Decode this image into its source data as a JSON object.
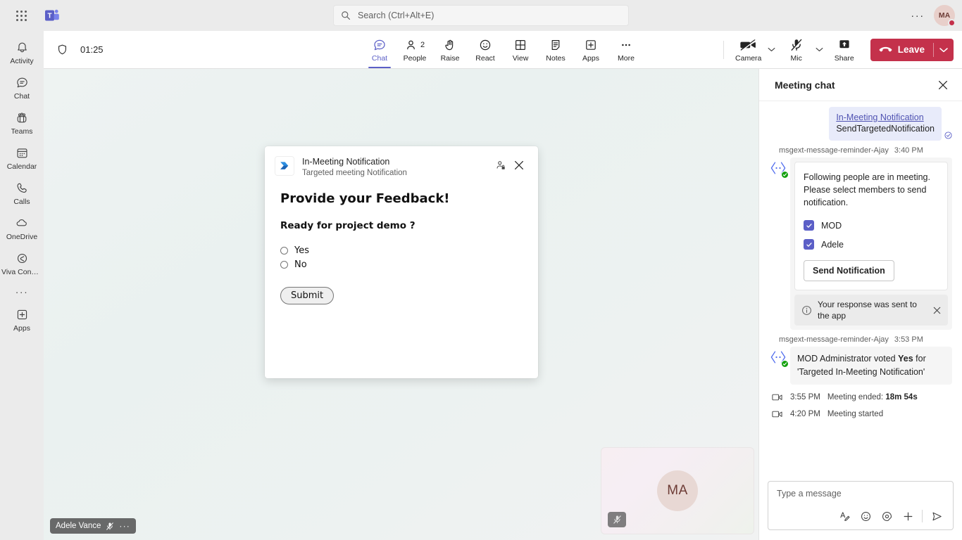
{
  "topbar": {
    "waffle_label": "app-launcher",
    "logo_label": "Microsoft Teams",
    "search_placeholder": "Search (Ctrl+Alt+E)",
    "more_label": "···",
    "avatar_initials": "MA"
  },
  "rail": {
    "items": [
      {
        "label": "Activity",
        "icon": "bell-icon"
      },
      {
        "label": "Chat",
        "icon": "chat-icon"
      },
      {
        "label": "Teams",
        "icon": "teams-icon"
      },
      {
        "label": "Calendar",
        "icon": "calendar-icon"
      },
      {
        "label": "Calls",
        "icon": "phone-icon"
      },
      {
        "label": "OneDrive",
        "icon": "cloud-icon"
      },
      {
        "label": "Viva Conne…",
        "icon": "viva-icon"
      }
    ],
    "more_label": "···",
    "apps_label": "Apps"
  },
  "meetbar": {
    "timer": "01:25",
    "shield_icon": "shield-icon",
    "controls": [
      {
        "label": "Chat",
        "icon": "chat-icon",
        "active": true,
        "count": ""
      },
      {
        "label": "People",
        "icon": "people-icon",
        "active": false,
        "count": "2"
      },
      {
        "label": "Raise",
        "icon": "hand-icon",
        "active": false,
        "count": ""
      },
      {
        "label": "React",
        "icon": "emoji-icon",
        "active": false,
        "count": ""
      },
      {
        "label": "View",
        "icon": "grid-icon",
        "active": false,
        "count": ""
      },
      {
        "label": "Notes",
        "icon": "notes-icon",
        "active": false,
        "count": ""
      },
      {
        "label": "Apps",
        "icon": "plus-box-icon",
        "active": false,
        "count": ""
      },
      {
        "label": "More",
        "icon": "ellipsis-icon",
        "active": false,
        "count": ""
      }
    ],
    "camera_label": "Camera",
    "mic_label": "Mic",
    "share_label": "Share",
    "leave_label": "Leave",
    "accent_color": "#5b5fc7",
    "leave_color": "#c4314b"
  },
  "stage": {
    "speaker_name": "Adele Vance",
    "speaker_dots": "···",
    "tile_initials": "MA"
  },
  "modal": {
    "app_title": "In-Meeting Notification",
    "app_subtitle": "Targeted meeting Notification",
    "heading": "Provide your Feedback!",
    "question": "Ready for project demo ?",
    "options": [
      {
        "label": "Yes",
        "selected": false
      },
      {
        "label": "No",
        "selected": false
      }
    ],
    "submit_label": "Submit"
  },
  "chat": {
    "title": "Meeting chat",
    "outgoing": {
      "link": "In-Meeting Notification",
      "subtitle": "SendTargetedNotification"
    },
    "message1": {
      "sender": "msgext-message-reminder-Ajay",
      "time": "3:40 PM",
      "card_text": "Following people are in meeting. Please select members to send notification.",
      "checkboxes": [
        {
          "label": "MOD",
          "checked": true
        },
        {
          "label": "Adele",
          "checked": true
        }
      ],
      "button_label": "Send Notification",
      "toast_text": "Your response was sent to the app"
    },
    "message2": {
      "sender": "msgext-message-reminder-Ajay",
      "time": "3:53 PM",
      "text_before": "MOD Administrator voted ",
      "text_bold": "Yes",
      "text_after": " for 'Targeted In-Meeting Notification'"
    },
    "system": [
      {
        "time": "3:55 PM",
        "text": "Meeting ended: ",
        "bold": "18m 54s"
      },
      {
        "time": "4:20 PM",
        "text": "Meeting started",
        "bold": ""
      }
    ],
    "composer_placeholder": "Type a message",
    "composer_tools": [
      "format-icon",
      "emoji-icon",
      "sticker-icon",
      "plus-icon",
      "send-icon"
    ]
  }
}
